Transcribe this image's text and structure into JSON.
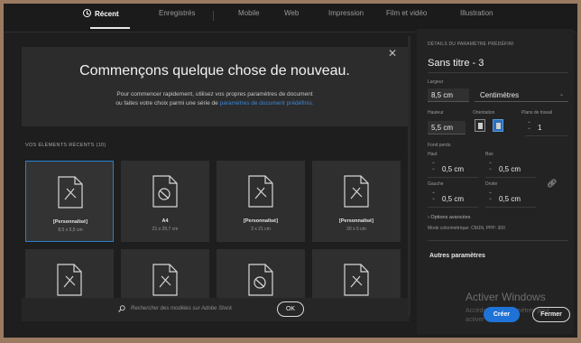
{
  "tabs": [
    {
      "label": "Récent",
      "active": true
    },
    {
      "label": "Enregistrés"
    },
    {
      "label": "Mobile"
    },
    {
      "label": "Web"
    },
    {
      "label": "Impression"
    },
    {
      "label": "Film et vidéo"
    },
    {
      "label": "Illustration"
    }
  ],
  "hero": {
    "title": "Commençons quelque chose de nouveau.",
    "line1": "Pour commencer rapidement, utilisez vos propres paramètres de document",
    "line2_prefix": "ou faites votre choix parmi une série de",
    "line2_link": "paramètres de document prédéfinis."
  },
  "recent": {
    "label": "VOS ÉLÉMENTS RÉCENTS",
    "count": "(10)",
    "items": [
      {
        "name": "[Personnalisé]",
        "size": "8,5 x 5,5 cm",
        "selected": true,
        "icon": "document-icon"
      },
      {
        "name": "A4",
        "size": "21 x 29,7 cm",
        "icon": "document-icon"
      },
      {
        "name": "[Personnalisé]",
        "size": "3 x 21 cm",
        "icon": "document-icon"
      },
      {
        "name": "[Personnalisé]",
        "size": "20 x 5 cm",
        "icon": "document-icon"
      }
    ]
  },
  "search": {
    "placeholder": "Rechercher des modèles sur Adobe Stock",
    "ok_label": "OK"
  },
  "preset": {
    "header": "DÉTAILS DU PARAMÈTRE PRÉDÉFINI",
    "name": "Sans titre - 3",
    "width_label": "Largeur",
    "width_value": "8,5 cm",
    "unit_value": "Centimètres",
    "height_label": "Hauteur",
    "height_value": "5,5 cm",
    "orientation_label": "Orientation",
    "artboards_label": "Plans de travail",
    "artboards_value": "1",
    "bleed_label": "Fond perdu",
    "top_label": "Haut",
    "top_value": "0,5 cm",
    "bottom_label": "Bas",
    "bottom_value": "0,5 cm",
    "left_label": "Gauche",
    "left_value": "0,5 cm",
    "right_label": "Droite",
    "right_value": "0,5 cm",
    "advanced_label": "Options avancées",
    "color_mode": "Mode colorimétrique: CMJN, PPP: 300",
    "more_settings": "Autres paramètres"
  },
  "watermark": {
    "title": "Activer Windows",
    "line1": "Accédez aux paramètres pour",
    "line2": "activer Windows."
  },
  "buttons": {
    "create": "Créer",
    "close": "Fermer"
  },
  "colors": {
    "accent": "#1f73d6",
    "selection": "#2a7fd1",
    "link": "#3b86d6"
  }
}
